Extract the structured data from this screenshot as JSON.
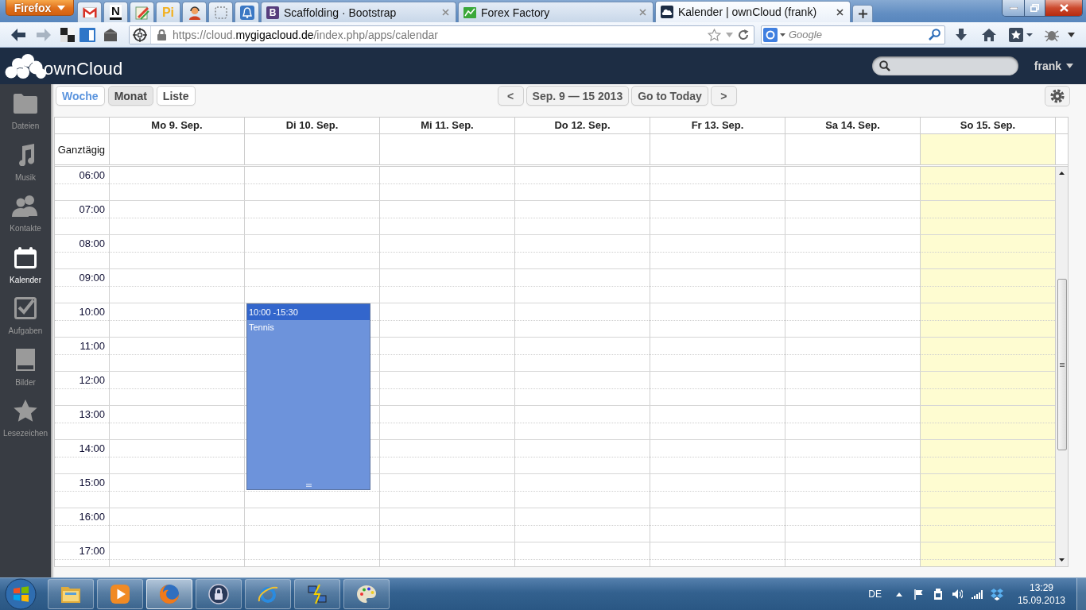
{
  "browser": {
    "menu_button": "Firefox",
    "pinned_tabs": [
      {
        "kind": "mail"
      },
      {
        "kind": "letter",
        "text": "N"
      },
      {
        "kind": "pencil"
      },
      {
        "kind": "letter",
        "text": "Pi"
      },
      {
        "kind": "person"
      },
      {
        "kind": "frame"
      },
      {
        "kind": "bell"
      }
    ],
    "tabs": [
      {
        "title": "Scaffolding · Bootstrap",
        "icon_text": "B",
        "selected": false
      },
      {
        "title": "Forex Factory",
        "selected": false
      },
      {
        "title": "Kalender | ownCloud (frank)",
        "selected": true
      }
    ],
    "nav_buttons": [
      {
        "disabled": false
      },
      {
        "disabled": true
      }
    ],
    "url": "https://cloud.**mygigacloud.de**/index.php/apps/calendar",
    "search": {
      "placeholder": "Google"
    }
  },
  "app_header": {
    "logo": "ownCloud",
    "user": "frank"
  },
  "sidebar": {
    "items": [
      {
        "label": "Dateien",
        "selected": false
      },
      {
        "label": "Musik",
        "selected": false
      },
      {
        "label": "Kontakte",
        "selected": false
      },
      {
        "label": "Kalender",
        "selected": true
      },
      {
        "label": "Aufgaben",
        "selected": false
      },
      {
        "label": "Bilder",
        "selected": false
      },
      {
        "label": "Lesezeichen",
        "selected": false
      }
    ]
  },
  "toolbar": {
    "views": [
      {
        "label": "Woche",
        "selected": true,
        "hovered": false
      },
      {
        "label": "Monat",
        "selected": false,
        "hovered": true
      },
      {
        "label": "Liste",
        "selected": false,
        "hovered": false
      }
    ],
    "prev": "<",
    "range": "Sep. 9 — 15 2013",
    "today": "Go to Today",
    "next": ">"
  },
  "calendar": {
    "all_day_label": "Ganztägig",
    "days": [
      {
        "label": "Mo 9. Sep.",
        "today": false
      },
      {
        "label": "Di 10. Sep.",
        "today": false,
        "events": [
          {
            "time": "10:00 -15:30",
            "title": "Tennis"
          }
        ]
      },
      {
        "label": "Mi 11. Sep.",
        "today": false
      },
      {
        "label": "Do 12. Sep.",
        "today": false
      },
      {
        "label": "Fr 13. Sep.",
        "today": false
      },
      {
        "label": "Sa 14. Sep.",
        "today": false
      },
      {
        "label": "So 15. Sep.",
        "today": true
      }
    ],
    "hours": [
      "06:00",
      "07:00",
      "08:00",
      "09:00",
      "10:00",
      "11:00",
      "12:00",
      "13:00",
      "14:00",
      "15:00",
      "16:00",
      "17:00"
    ]
  },
  "taskbar": {
    "apps": [
      {
        "selected": false
      },
      {
        "selected": false
      },
      {
        "selected": true
      },
      {
        "selected": false
      },
      {
        "selected": false
      },
      {
        "selected": false
      },
      {
        "selected": false
      }
    ],
    "language": "DE",
    "time": "13:29",
    "date": "15.09.2013"
  }
}
